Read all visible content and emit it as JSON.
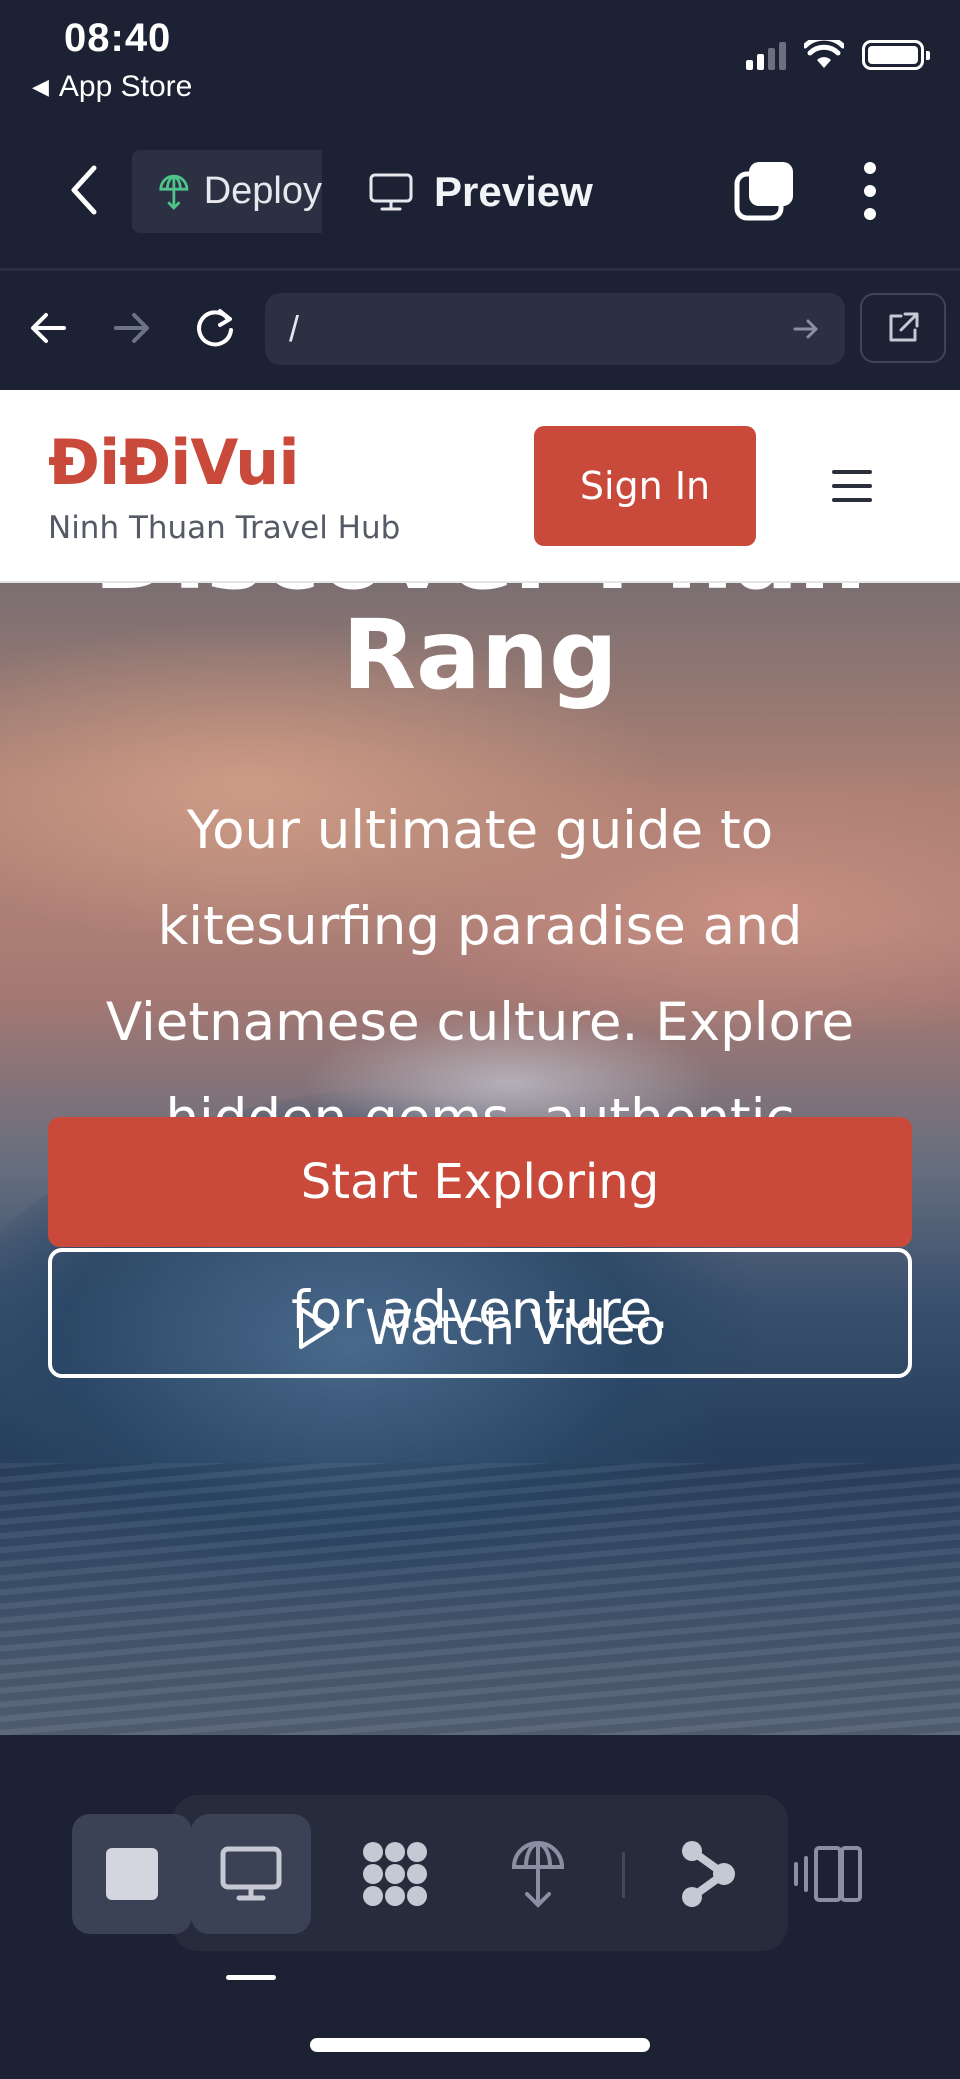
{
  "status_bar": {
    "time": "08:40",
    "back_app": "App Store",
    "back_icon": "◀"
  },
  "toolbar": {
    "deploy_label": "Deploy",
    "preview_label": "Preview"
  },
  "browser": {
    "url": "/"
  },
  "site": {
    "logo": "ĐiĐiVui",
    "tagline": "Ninh Thuan Travel Hub",
    "signin_label": "Sign In"
  },
  "hero": {
    "title": "Discover Phan Rang",
    "description": "Your ultimate guide to kitesurfing paradise and Vietnamese culture. Explore hidden gems, authentic experiences, and the best spots for adventure.",
    "primary_cta": "Start Exploring",
    "secondary_cta": "Watch Video"
  },
  "colors": {
    "brand": "#c94a3b",
    "app_bg": "#1c2233",
    "panel": "#2b3142",
    "deploy_icon": "#4fc38a"
  },
  "dock": {
    "items": [
      "stop-icon",
      "desktop-icon",
      "apps-grid-icon",
      "deploy-icon",
      "branch-icon",
      "device-resize-icon"
    ],
    "active": "desktop-icon"
  }
}
